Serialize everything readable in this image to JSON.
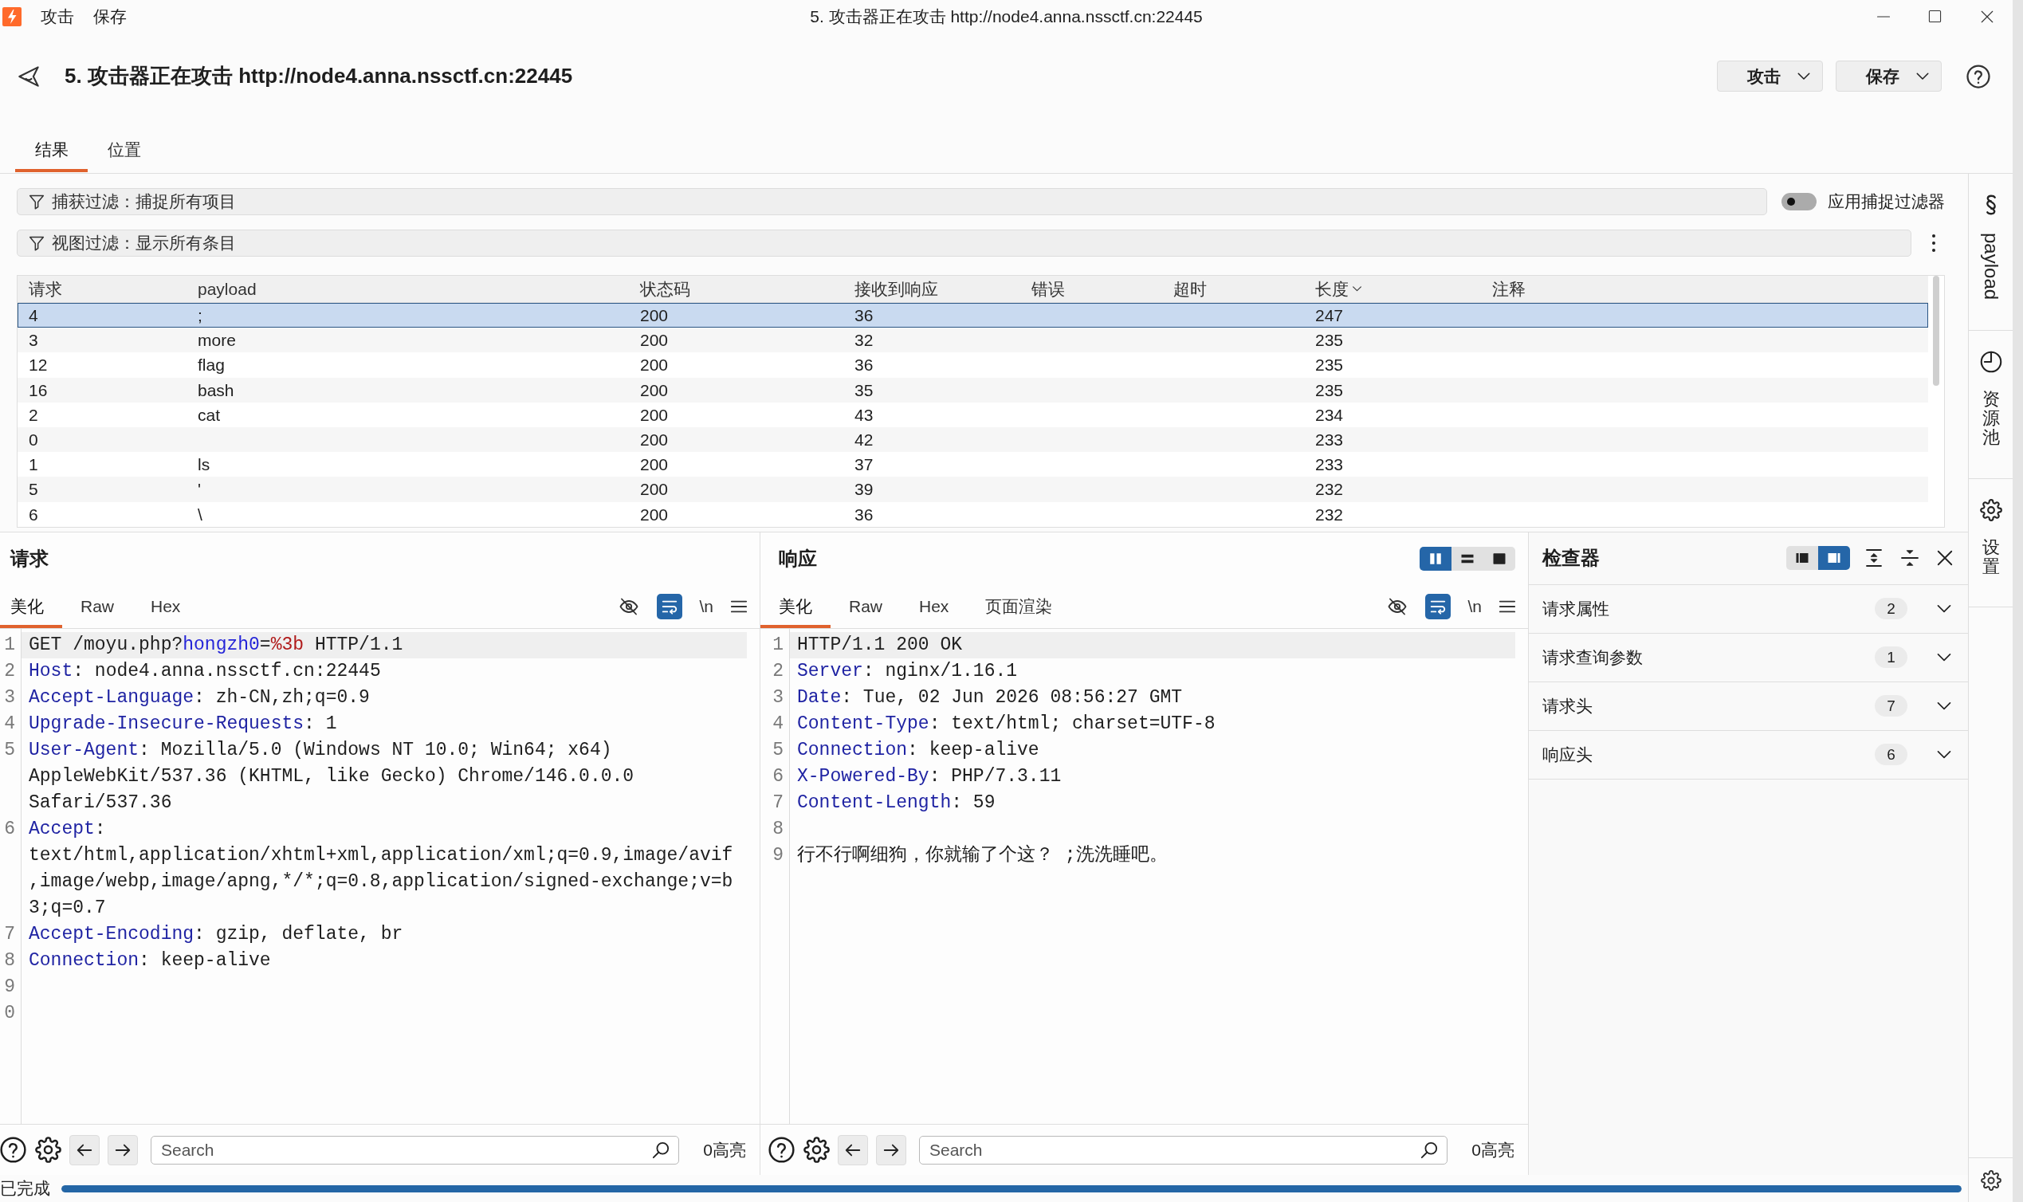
{
  "title_bar": {
    "menus": [
      "攻击",
      "保存"
    ],
    "title": "5. 攻击器正在攻击 http://node4.anna.nssctf.cn:22445"
  },
  "header": {
    "title": "5. 攻击器正在攻击 http://node4.anna.nssctf.cn:22445",
    "buttons": [
      "攻击",
      "保存"
    ]
  },
  "tabs": [
    {
      "label": "结果",
      "selected": true
    },
    {
      "label": "位置",
      "selected": false
    }
  ],
  "capture_filter": {
    "label": "捕获过滤：捕捉所有项目",
    "toggle": {
      "label": "应用捕捉过滤器",
      "on": false
    }
  },
  "view_filter": {
    "label": "视图过滤：显示所有条目"
  },
  "results_table": {
    "columns": [
      {
        "label": "请求"
      },
      {
        "label": "payload"
      },
      {
        "label": "状态码"
      },
      {
        "label": "接收到响应"
      },
      {
        "label": "错误"
      },
      {
        "label": "超时"
      },
      {
        "label": "长度",
        "sorted": true
      },
      {
        "label": "注释"
      }
    ],
    "rows": [
      {
        "request": "4",
        "payload": ";",
        "status": "200",
        "received": "36",
        "length": "247",
        "selected": true
      },
      {
        "request": "3",
        "payload": "more",
        "status": "200",
        "received": "32",
        "length": "235",
        "selected": false
      },
      {
        "request": "12",
        "payload": "flag",
        "status": "200",
        "received": "36",
        "length": "235",
        "selected": false
      },
      {
        "request": "16",
        "payload": "bash",
        "status": "200",
        "received": "35",
        "length": "235",
        "selected": false
      },
      {
        "request": "2",
        "payload": "cat",
        "status": "200",
        "received": "43",
        "length": "234",
        "selected": false
      },
      {
        "request": "0",
        "status": "200",
        "received": "42",
        "length": "233",
        "selected": false
      },
      {
        "request": "1",
        "payload": "ls",
        "status": "200",
        "received": "37",
        "length": "233",
        "selected": false
      },
      {
        "request": "5",
        "payload": "'",
        "status": "200",
        "received": "39",
        "length": "232",
        "selected": false
      },
      {
        "request": "6",
        "payload": "\\",
        "status": "200",
        "received": "36",
        "length": "232",
        "selected": false
      }
    ]
  },
  "request_pane": {
    "title": "请求",
    "tabs": [
      {
        "label": "美化",
        "selected": true
      },
      {
        "label": "Raw",
        "selected": false
      },
      {
        "label": "Hex",
        "selected": false
      }
    ],
    "tools": [
      {
        "kind": "hide",
        "on": false
      },
      {
        "kind": "wrap",
        "on": true
      },
      {
        "kind": "newline",
        "label": "\\n",
        "on": false
      },
      {
        "kind": "menu"
      }
    ],
    "lines": [
      {
        "number": "1",
        "current": true,
        "segments": [
          {
            "kind": "plain",
            "text": "GET /moyu.php?"
          },
          {
            "kind": "param",
            "text": "hongzh0"
          },
          {
            "kind": "plain",
            "text": "="
          },
          {
            "kind": "value",
            "text": "%3b"
          },
          {
            "kind": "plain",
            "text": " HTTP/1.1"
          }
        ]
      },
      {
        "number": "2",
        "current": false,
        "segments": [
          {
            "kind": "key",
            "text": "Host"
          },
          {
            "kind": "plain",
            "text": ": node4.anna.nssctf.cn:22445"
          }
        ]
      },
      {
        "number": "3",
        "current": false,
        "segments": [
          {
            "kind": "key",
            "text": "Accept-Language"
          },
          {
            "kind": "plain",
            "text": ": zh-CN,zh;q=0.9"
          }
        ]
      },
      {
        "number": "4",
        "current": false,
        "segments": [
          {
            "kind": "key",
            "text": "Upgrade-Insecure-Requests"
          },
          {
            "kind": "plain",
            "text": ": 1"
          }
        ]
      },
      {
        "number": "5",
        "current": false,
        "segments": [
          {
            "kind": "key",
            "text": "User-Agent"
          },
          {
            "kind": "plain",
            "text": ": Mozilla/5.0 (Windows NT 10.0; Win64; x64)"
          }
        ],
        "wrapped": [
          "AppleWebKit/537.36 (KHTML, like Gecko) Chrome/146.0.0.0",
          "Safari/537.36"
        ]
      },
      {
        "number": "6",
        "current": false,
        "segments": [
          {
            "kind": "key",
            "text": "Accept"
          },
          {
            "kind": "plain",
            "text": ":"
          }
        ],
        "wrapped": [
          "text/html,application/xhtml+xml,application/xml;q=0.9,image/avif",
          ",image/webp,image/apng,*/*;q=0.8,application/signed-exchange;v=b",
          "3;q=0.7"
        ]
      },
      {
        "number": "7",
        "current": false,
        "segments": [
          {
            "kind": "key",
            "text": "Accept-Encoding"
          },
          {
            "kind": "plain",
            "text": ": gzip, deflate, br"
          }
        ]
      },
      {
        "number": "8",
        "current": false,
        "segments": [
          {
            "kind": "key",
            "text": "Connection"
          },
          {
            "kind": "plain",
            "text": ": keep-alive"
          }
        ]
      },
      {
        "number": "9",
        "current": false
      },
      {
        "number": "0",
        "current": false
      }
    ],
    "search": {
      "placeholder": "Search"
    },
    "highlights": "0高亮"
  },
  "response_pane": {
    "title": "响应",
    "layout": [
      {
        "kind": "columns",
        "selected": true
      },
      {
        "kind": "rows",
        "selected": false
      },
      {
        "kind": "single",
        "selected": false
      }
    ],
    "tabs": [
      {
        "label": "美化",
        "selected": true
      },
      {
        "label": "Raw",
        "selected": false
      },
      {
        "label": "Hex",
        "selected": false
      },
      {
        "label": "页面渲染",
        "selected": false
      }
    ],
    "tools": [
      {
        "kind": "hide",
        "on": false
      },
      {
        "kind": "wrap",
        "on": true
      },
      {
        "kind": "newline",
        "label": "\\n",
        "on": false
      },
      {
        "kind": "menu"
      }
    ],
    "lines": [
      {
        "number": "1",
        "current": true,
        "segments": [
          {
            "kind": "plain",
            "text": "HTTP/1.1 200 OK"
          }
        ]
      },
      {
        "number": "2",
        "current": false,
        "segments": [
          {
            "kind": "key",
            "text": "Server"
          },
          {
            "kind": "plain",
            "text": ": nginx/1.16.1"
          }
        ]
      },
      {
        "number": "3",
        "current": false,
        "segments": [
          {
            "kind": "key",
            "text": "Date"
          },
          {
            "kind": "plain",
            "text": ": Tue, 02 Jun 2026 08:56:27 GMT"
          }
        ]
      },
      {
        "number": "4",
        "current": false,
        "segments": [
          {
            "kind": "key",
            "text": "Content-Type"
          },
          {
            "kind": "plain",
            "text": ": text/html; charset=UTF-8"
          }
        ]
      },
      {
        "number": "5",
        "current": false,
        "segments": [
          {
            "kind": "key",
            "text": "Connection"
          },
          {
            "kind": "plain",
            "text": ": keep-alive"
          }
        ]
      },
      {
        "number": "6",
        "current": false,
        "segments": [
          {
            "kind": "key",
            "text": "X-Powered-By"
          },
          {
            "kind": "plain",
            "text": ": PHP/7.3.11"
          }
        ]
      },
      {
        "number": "7",
        "current": false,
        "segments": [
          {
            "kind": "key",
            "text": "Content-Length"
          },
          {
            "kind": "plain",
            "text": ": 59"
          }
        ]
      },
      {
        "number": "8",
        "current": false
      },
      {
        "number": "9",
        "current": false,
        "segments": [
          {
            "kind": "plain",
            "text": "行不行啊细狗，你就输了个这？ ;洗洗睡吧。"
          }
        ]
      }
    ],
    "search": {
      "placeholder": "Search"
    },
    "highlights": "0高亮"
  },
  "inspector": {
    "title": "检查器",
    "layout": [
      {
        "kind": "left",
        "selected": false
      },
      {
        "kind": "right",
        "selected": true
      }
    ],
    "sections": [
      {
        "label": "请求属性",
        "count": "2",
        "expanded": false
      },
      {
        "label": "请求查询参数",
        "count": "1",
        "expanded": false
      },
      {
        "label": "请求头",
        "count": "7",
        "expanded": false
      },
      {
        "label": "响应头",
        "count": "6",
        "expanded": false
      }
    ]
  },
  "sidebar": {
    "items": [
      {
        "kind": "payload",
        "label": "payload"
      },
      {
        "kind": "resource",
        "label": "资源池"
      },
      {
        "kind": "settings",
        "label": "设置"
      }
    ]
  },
  "status_bar": {
    "text": "已完成",
    "progress": {
      "level": 1
    }
  }
}
